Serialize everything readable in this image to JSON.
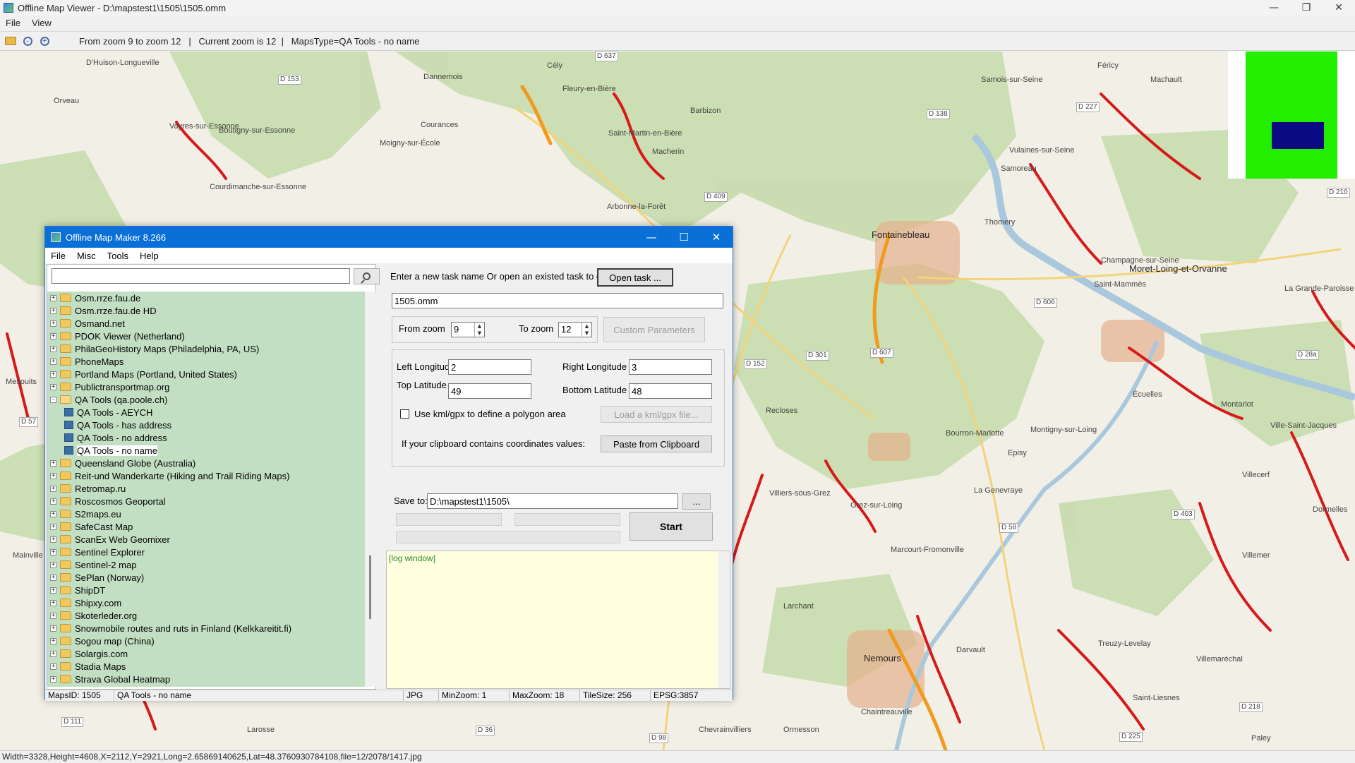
{
  "viewer": {
    "title": "Offline Map Viewer - D:\\mapstest1\\1505\\1505.omm",
    "menu": [
      "File",
      "View"
    ],
    "toolbar_status": "From zoom 9 to zoom 12   |   Current zoom is 12  |   MapsType=QA Tools - no name",
    "status": "Width=3328,Height=4608,X=2112,Y=2921,Long=2.65869140625,Lat=48.3760930784108,file=12/2078/1417.jpg"
  },
  "map": {
    "towns": [
      "Fontainebleau",
      "Moret-Loing-et-Orvanne",
      "Nemours",
      "Champagne-sur-Seine",
      "Saint-Mammès",
      "Montigny-sur-Loing",
      "Bourron-Marlotte",
      "Recloses",
      "Villiers-sous-Grez",
      "Grez-sur-Loing",
      "Larchant",
      "Darvault",
      "Dormelles",
      "Villecerf",
      "Villemer",
      "Écuelles",
      "Montarlot",
      "Thomery",
      "Samoreau",
      "Vulaines-sur-Seine",
      "Samois-sur-Seine",
      "Machault",
      "Féricy",
      "Barbizon",
      "Dannemois",
      "Cély",
      "Fleury-en-Bière",
      "Saint-Martin-en-Bière",
      "Macherin",
      "Courances",
      "Moigny-sur-École",
      "Vayres-sur-Essonne",
      "Boutigny-sur-Essonne",
      "Courdimanche-sur-Essonne",
      "D'Huison-Longueville",
      "Orveau",
      "Arbonne-la-Forêt",
      "La Genevraye",
      "Marcourt-Fromonville",
      "Episy",
      "La Grande-Paroisse",
      "Ville-Saint-Jacques",
      "Saint-Liesnes",
      "Treuzy-Levelay",
      "Villemaréchal",
      "Chevrainvilliers",
      "Ormesson",
      "Chaintreauville",
      "Larosse",
      "Mespuits",
      "Mainville",
      "Paley"
    ],
    "roads": [
      "D 153",
      "D 637",
      "D 138",
      "D 227",
      "D 409",
      "D 606",
      "D 607",
      "D 301",
      "D 152",
      "D 57",
      "D 58",
      "D 403",
      "D 218",
      "D 225",
      "D 36",
      "D 98",
      "D 111",
      "D 28a",
      "D 210"
    ],
    "colors": {
      "background": "#f2efe6",
      "forest": "#c9dcb0",
      "road": "#d61a1a",
      "water": "#a9c8dd",
      "urban": "#e5b08c"
    }
  },
  "dialog": {
    "title": "Offline Map Maker 8.266",
    "menu": [
      "File",
      "Misc",
      "Tools",
      "Help"
    ],
    "search_value": "",
    "tree": [
      {
        "label": "Osm.rrze.fau.de",
        "type": "folder"
      },
      {
        "label": "Osm.rrze.fau.de HD",
        "type": "folder"
      },
      {
        "label": "Osmand.net",
        "type": "folder"
      },
      {
        "label": "PDOK Viewer (Netherland)",
        "type": "folder"
      },
      {
        "label": "PhilaGeoHistory Maps (Philadelphia, PA, US)",
        "type": "folder"
      },
      {
        "label": "PhoneMaps",
        "type": "folder"
      },
      {
        "label": "Portland Maps (Portland, United States)",
        "type": "folder"
      },
      {
        "label": "Publictransportmap.org",
        "type": "folder"
      },
      {
        "label": "QA Tools (qa.poole.ch)",
        "type": "folder-open"
      },
      {
        "label": "QA Tools - AEYCH",
        "type": "map"
      },
      {
        "label": "QA Tools - has address",
        "type": "map"
      },
      {
        "label": "QA Tools - no address",
        "type": "map"
      },
      {
        "label": "QA Tools - no name",
        "type": "map",
        "selected": true
      },
      {
        "label": "Queensland Globe (Australia)",
        "type": "folder"
      },
      {
        "label": "Reit-und Wanderkarte (Hiking and Trail Riding Maps)",
        "type": "folder"
      },
      {
        "label": "Retromap.ru",
        "type": "folder"
      },
      {
        "label": "Roscosmos Geoportal",
        "type": "folder"
      },
      {
        "label": "S2maps.eu",
        "type": "folder"
      },
      {
        "label": "SafeCast Map",
        "type": "folder"
      },
      {
        "label": "ScanEx Web Geomixer",
        "type": "folder"
      },
      {
        "label": "Sentinel Explorer",
        "type": "folder"
      },
      {
        "label": "Sentinel-2 map",
        "type": "folder"
      },
      {
        "label": "SePlan (Norway)",
        "type": "folder"
      },
      {
        "label": "ShipDT",
        "type": "folder"
      },
      {
        "label": "Shipxy.com",
        "type": "folder"
      },
      {
        "label": "Skoterleder.org",
        "type": "folder"
      },
      {
        "label": "Snowmobile routes and ruts in Finland (Kelkkareitit.fi)",
        "type": "folder"
      },
      {
        "label": "Sogou map (China)",
        "type": "folder"
      },
      {
        "label": "Solargis.com",
        "type": "folder"
      },
      {
        "label": "Stadia Maps",
        "type": "folder"
      },
      {
        "label": "Strava Global Heatmap",
        "type": "folder"
      }
    ],
    "task_prompt": "Enter a new task name Or open an existed task to continue:",
    "open_task_label": "Open task ...",
    "task_name": "1505.omm",
    "from_zoom_label": "From zoom",
    "from_zoom": "9",
    "to_zoom_label": "To zoom",
    "to_zoom": "12",
    "custom_params_label": "Custom Parameters",
    "left_lon_label": "Left Longitude",
    "left_lon": "2",
    "right_lon_label": "Right Longitude",
    "right_lon": "3",
    "top_lat_label": "Top Latitude",
    "top_lat": "49",
    "bottom_lat_label": "Bottom Latitude",
    "bottom_lat": "48",
    "kml_label": "Use kml/gpx to define a polygon area",
    "load_kml_label": "Load a kml/gpx file...",
    "clipboard_prompt": "If your clipboard contains coordinates values:",
    "paste_label": "Paste from Clipboard",
    "save_to_label": "Save to:",
    "save_to": "D:\\mapstest1\\1505\\",
    "browse_label": "...",
    "start_label": "Start",
    "log_text": "[log window]",
    "status": {
      "maps_id": "MapsID: 1505",
      "name": "QA Tools - no name",
      "format": "JPG",
      "min_zoom": "MinZoom: 1",
      "max_zoom": "MaxZoom: 18",
      "tile_size": "TileSize: 256",
      "epsg": "EPSG:3857"
    }
  }
}
